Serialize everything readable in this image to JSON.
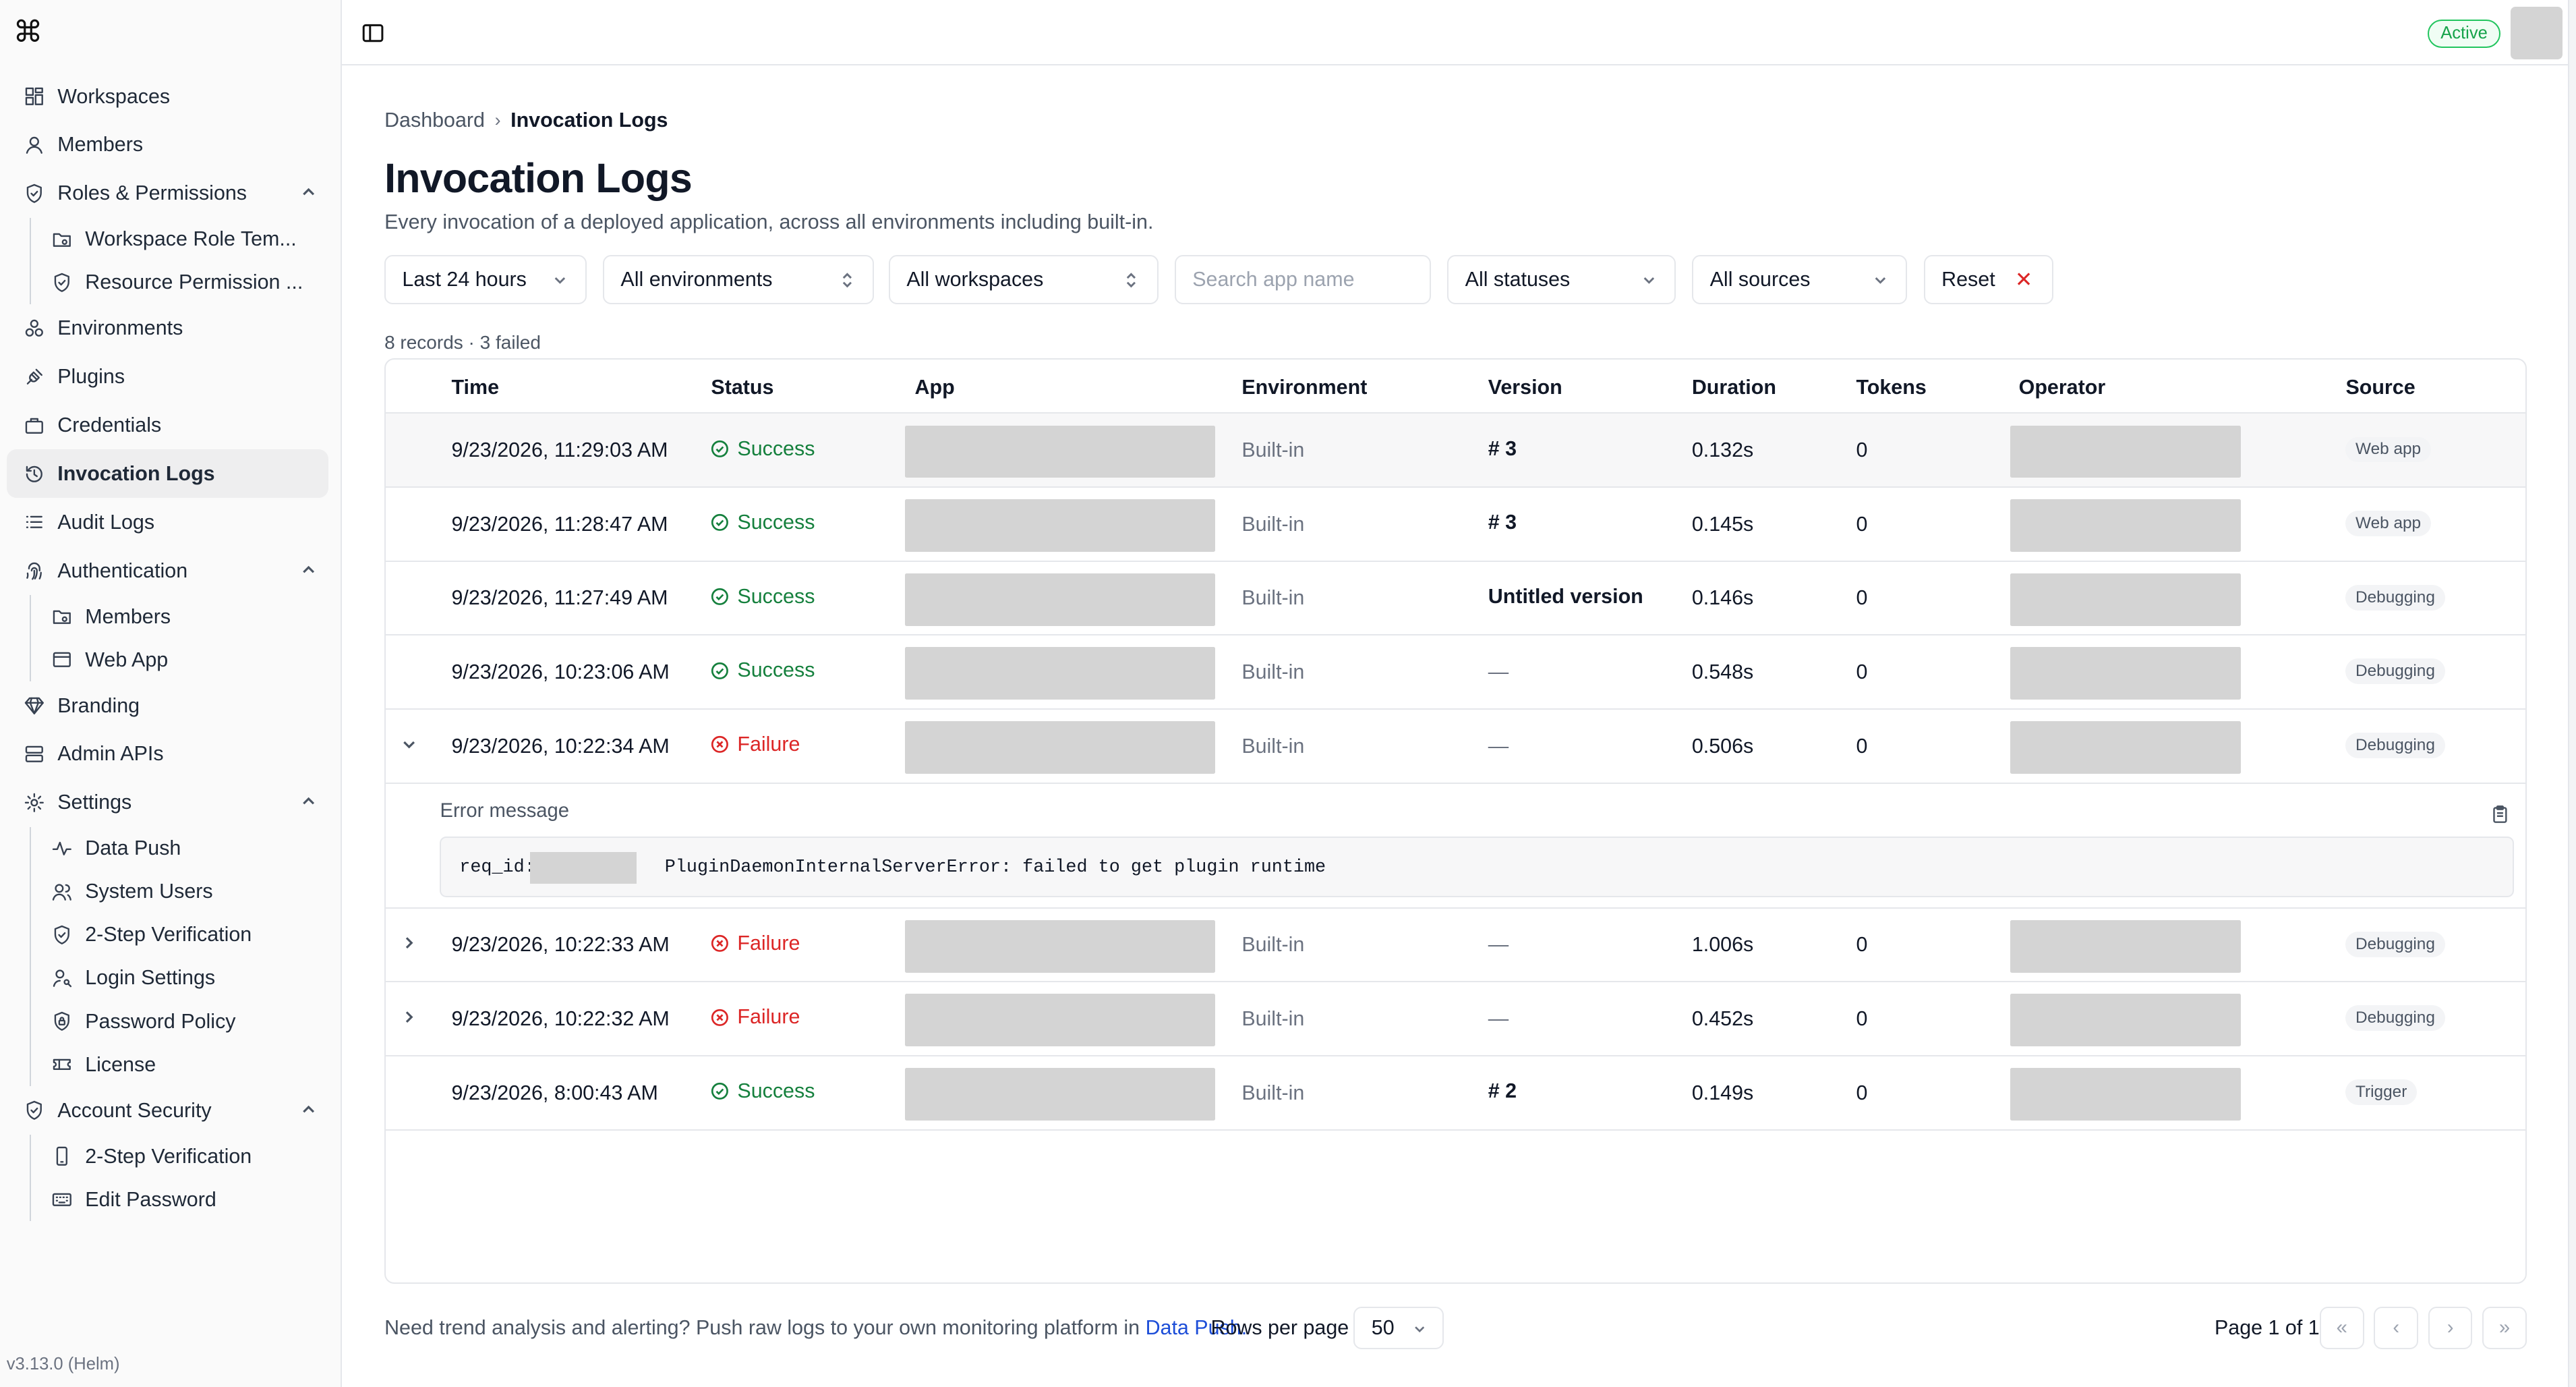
{
  "app": {
    "version": "v3.13.0 (Helm)",
    "status": "Active"
  },
  "sidebar": {
    "items": [
      {
        "label": "Workspaces",
        "icon": "grid-icon"
      },
      {
        "label": "Members",
        "icon": "user-icon"
      },
      {
        "label": "Roles & Permissions",
        "icon": "shield-icon",
        "expanded": true,
        "children": [
          {
            "label": "Workspace Role Tem...",
            "icon": "folder-icon"
          },
          {
            "label": "Resource Permission ...",
            "icon": "shield-icon"
          }
        ]
      },
      {
        "label": "Environments",
        "icon": "cluster-icon"
      },
      {
        "label": "Plugins",
        "icon": "plug-icon"
      },
      {
        "label": "Credentials",
        "icon": "briefcase-icon"
      },
      {
        "label": "Invocation Logs",
        "icon": "history-icon",
        "active": true
      },
      {
        "label": "Audit Logs",
        "icon": "list-icon"
      },
      {
        "label": "Authentication",
        "icon": "fingerprint-icon",
        "expanded": true,
        "children": [
          {
            "label": "Members",
            "icon": "folder-icon"
          },
          {
            "label": "Web App",
            "icon": "browser-icon"
          }
        ]
      },
      {
        "label": "Branding",
        "icon": "gem-icon"
      },
      {
        "label": "Admin APIs",
        "icon": "server-icon"
      },
      {
        "label": "Settings",
        "icon": "gear-icon",
        "expanded": true,
        "children": [
          {
            "label": "Data Push",
            "icon": "activity-icon"
          },
          {
            "label": "System Users",
            "icon": "users-icon"
          },
          {
            "label": "2-Step Verification",
            "icon": "shield-icon"
          },
          {
            "label": "Login Settings",
            "icon": "user-key-icon"
          },
          {
            "label": "Password Policy",
            "icon": "shield-lock-icon"
          },
          {
            "label": "License",
            "icon": "ticket-icon"
          }
        ]
      },
      {
        "label": "Account Security",
        "icon": "shield-icon",
        "expanded": true,
        "children": [
          {
            "label": "2-Step Verification",
            "icon": "phone-icon"
          },
          {
            "label": "Edit Password",
            "icon": "keyboard-icon"
          }
        ]
      }
    ]
  },
  "breadcrumb": {
    "parent": "Dashboard",
    "current": "Invocation Logs"
  },
  "page": {
    "title": "Invocation Logs",
    "subtitle": "Every invocation of a deployed application, across all environments including built-in."
  },
  "filters": {
    "time": "Last 24 hours",
    "environment": "All environments",
    "workspace": "All workspaces",
    "search_placeholder": "Search app name",
    "status": "All statuses",
    "source": "All sources",
    "reset": "Reset"
  },
  "records_summary": "8 records · 3 failed",
  "table": {
    "columns": [
      "Time",
      "Status",
      "App",
      "Environment",
      "Version",
      "Duration",
      "Tokens",
      "Operator",
      "Source"
    ],
    "rows": [
      {
        "time": "9/23/2026, 11:29:03 AM",
        "status": "Success",
        "env": "Built-in",
        "version": "# 3",
        "duration": "0.132s",
        "tokens": "0",
        "source": "Web app",
        "expander": "",
        "highlight": true
      },
      {
        "time": "9/23/2026, 11:28:47 AM",
        "status": "Success",
        "env": "Built-in",
        "version": "# 3",
        "duration": "0.145s",
        "tokens": "0",
        "source": "Web app",
        "expander": ""
      },
      {
        "time": "9/23/2026, 11:27:49 AM",
        "status": "Success",
        "env": "Built-in",
        "version": "Untitled version",
        "duration": "0.146s",
        "tokens": "0",
        "source": "Debugging",
        "expander": ""
      },
      {
        "time": "9/23/2026, 10:23:06 AM",
        "status": "Success",
        "env": "Built-in",
        "version": "—",
        "duration": "0.548s",
        "tokens": "0",
        "source": "Debugging",
        "expander": ""
      },
      {
        "time": "9/23/2026, 10:22:34 AM",
        "status": "Failure",
        "env": "Built-in",
        "version": "—",
        "duration": "0.506s",
        "tokens": "0",
        "source": "Debugging",
        "expander": "down"
      },
      {
        "time": "9/23/2026, 10:22:33 AM",
        "status": "Failure",
        "env": "Built-in",
        "version": "—",
        "duration": "1.006s",
        "tokens": "0",
        "source": "Debugging",
        "expander": "right"
      },
      {
        "time": "9/23/2026, 10:22:32 AM",
        "status": "Failure",
        "env": "Built-in",
        "version": "—",
        "duration": "0.452s",
        "tokens": "0",
        "source": "Debugging",
        "expander": "right"
      },
      {
        "time": "9/23/2026, 8:00:43 AM",
        "status": "Success",
        "env": "Built-in",
        "version": "# 2",
        "duration": "0.149s",
        "tokens": "0",
        "source": "Trigger",
        "expander": ""
      }
    ],
    "error": {
      "label": "Error message",
      "req_prefix": "req_id:",
      "message": "PluginDaemonInternalServerError: failed to get plugin runtime"
    }
  },
  "footer": {
    "note": "Need trend analysis and alerting? Push raw logs to your own monitoring platform in",
    "link": "Data Push.",
    "rows_label": "Rows per page",
    "rows_value": "50",
    "page_label": "Page 1 of 1"
  },
  "colors": {
    "success": "#15803d",
    "failure": "#dc2626",
    "link": "#1d4ed8",
    "active_green": "#16a34a"
  }
}
